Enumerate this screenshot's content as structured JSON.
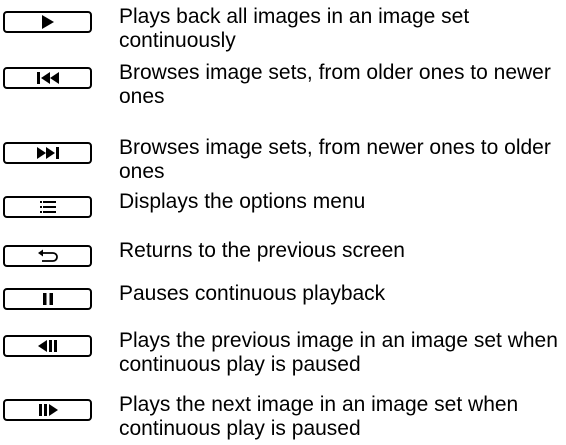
{
  "controls": [
    {
      "icon": "play-icon",
      "description": "Plays back all images in an image set continuously"
    },
    {
      "icon": "skip-back-icon",
      "description": "Browses image sets, from older ones to newer ones"
    },
    {
      "icon": "skip-forward-icon",
      "description": "Browses image sets, from newer ones to older ones"
    },
    {
      "icon": "menu-icon",
      "description": "Displays the options menu"
    },
    {
      "icon": "return-icon",
      "description": "Returns to the previous screen"
    },
    {
      "icon": "pause-icon",
      "description": "Pauses continuous playback"
    },
    {
      "icon": "step-back-icon",
      "description": "Plays the previous image in an image set when continuous play is paused"
    },
    {
      "icon": "step-forward-icon",
      "description": "Plays the next image in an image set when continuous play is paused"
    }
  ]
}
